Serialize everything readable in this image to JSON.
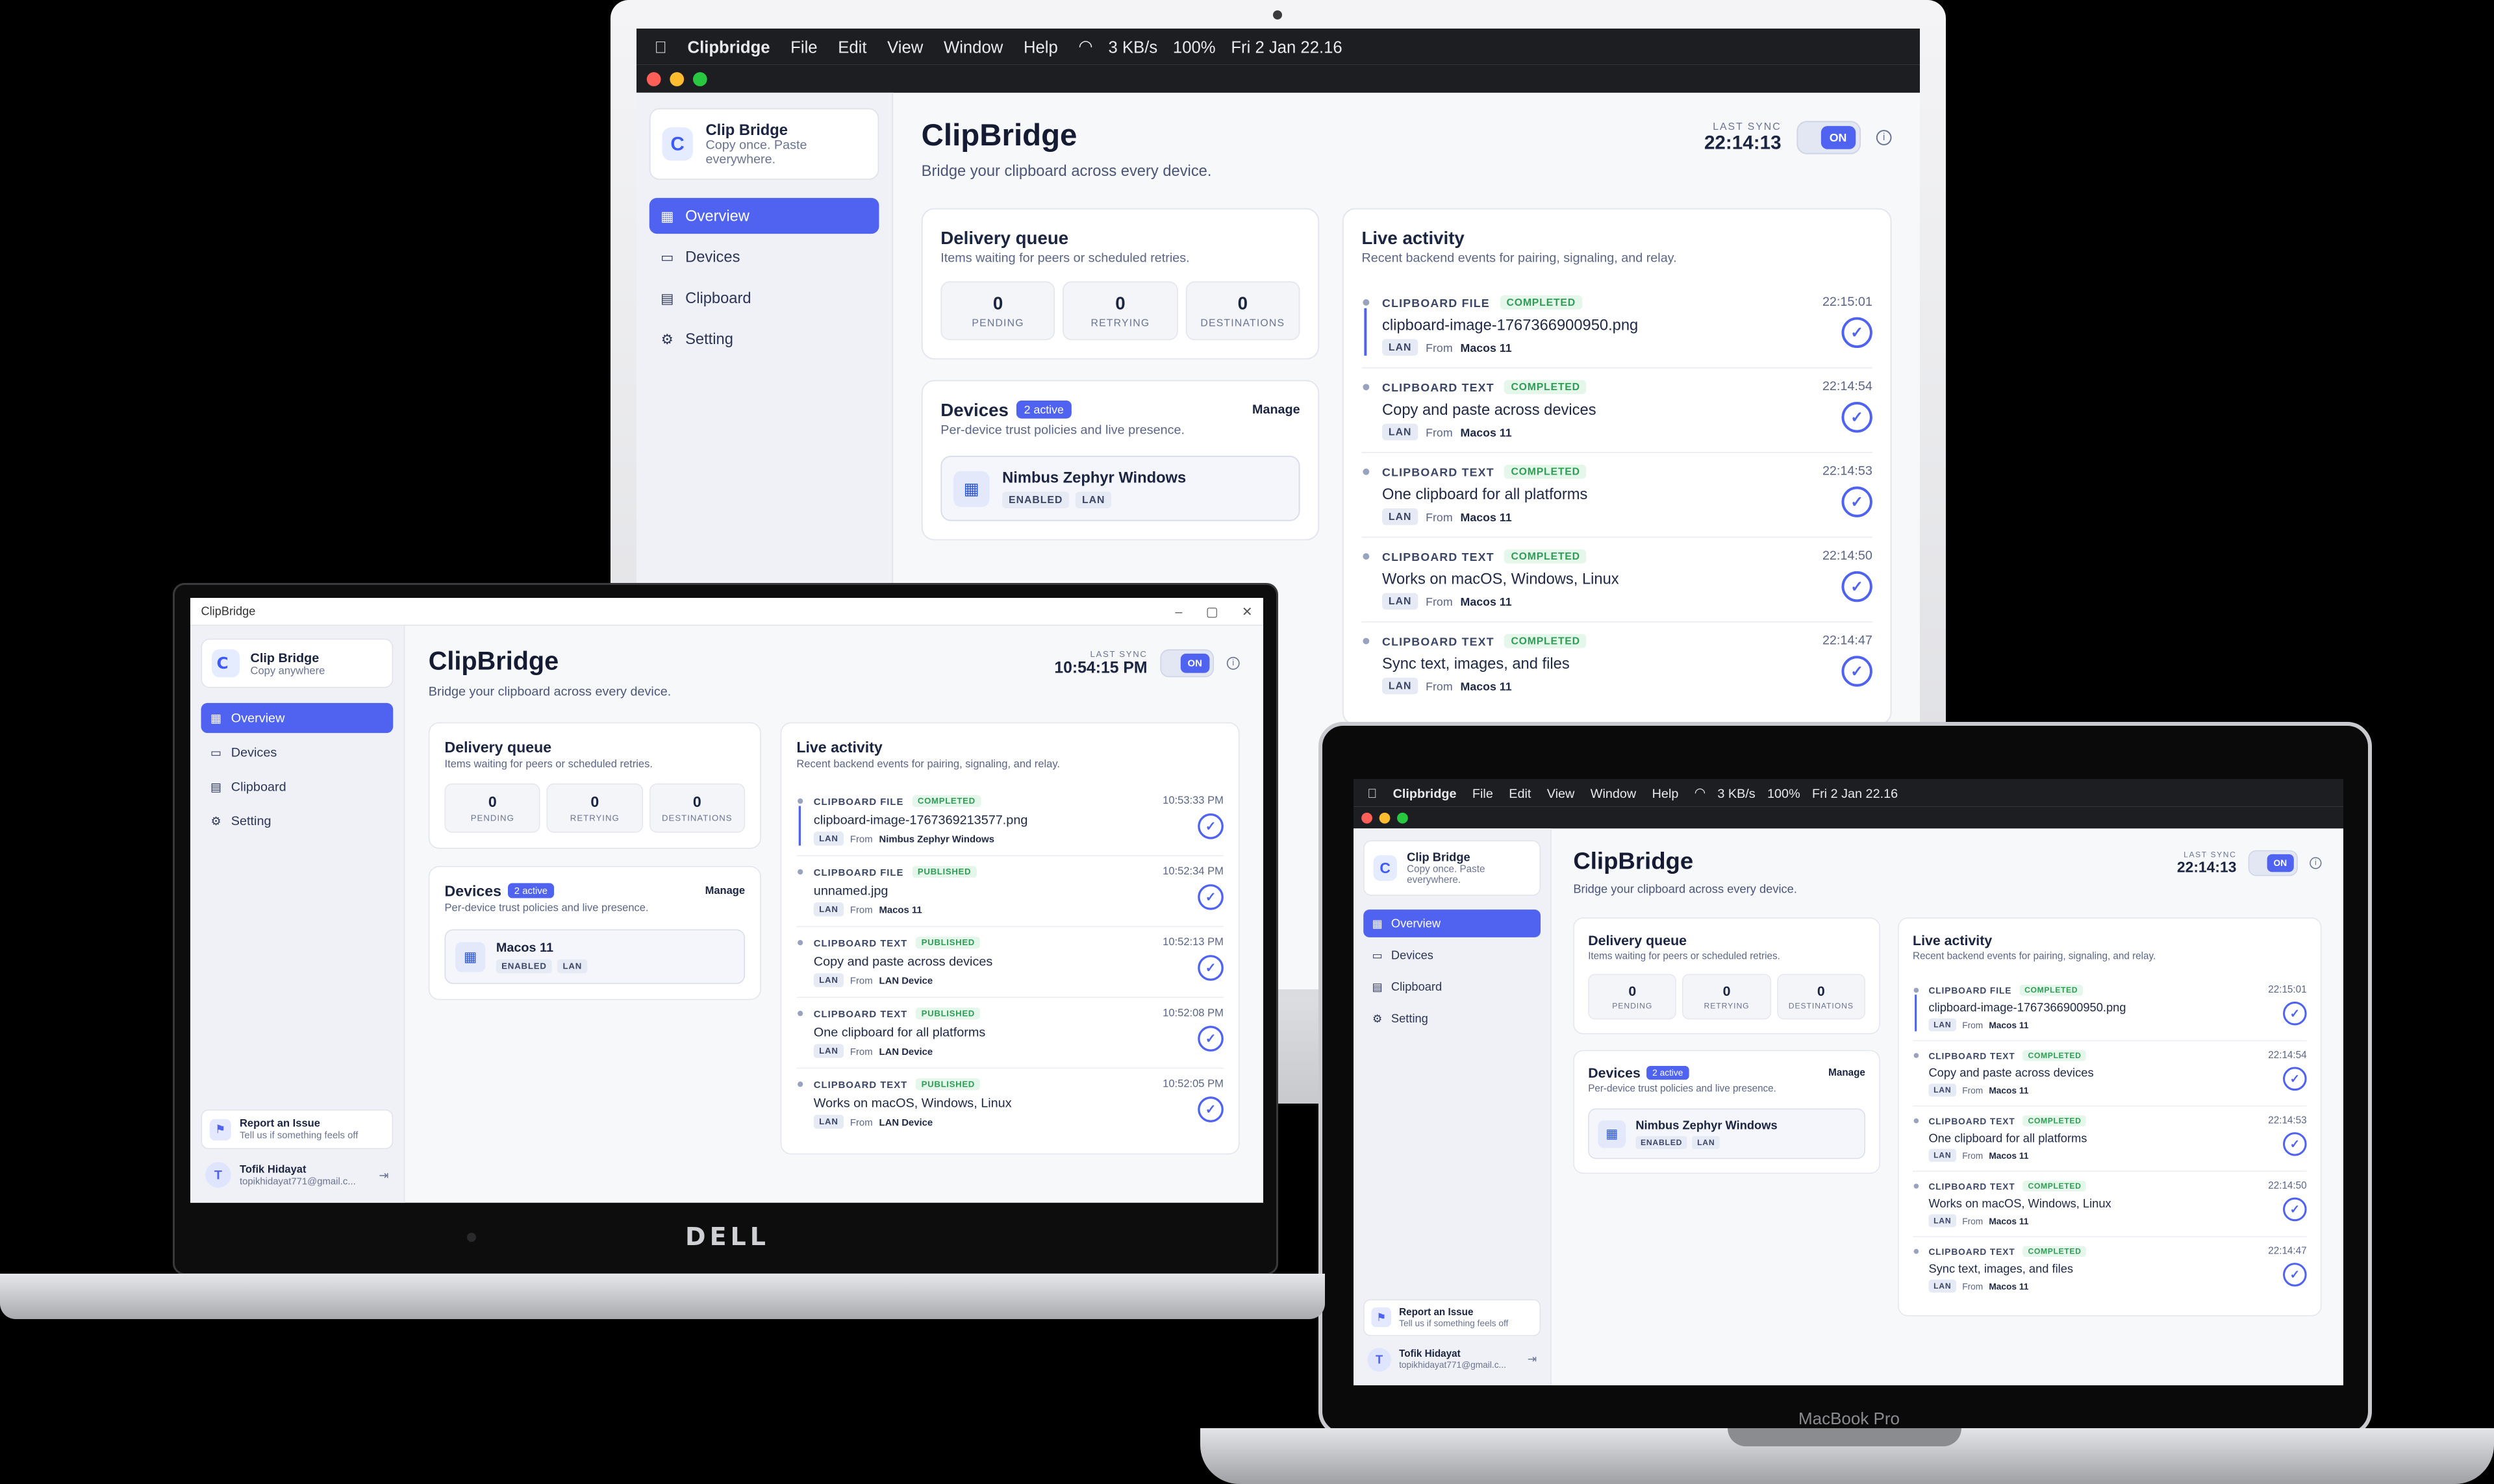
{
  "colors": {
    "accent": "#4f63f0",
    "success": "#2f9d55"
  },
  "hardware": {
    "dell_logo": "DELL",
    "macbook_label": "MacBook Pro"
  },
  "mac_menubar": {
    "apple": "",
    "app": "Clipbridge",
    "menus": [
      "File",
      "Edit",
      "View",
      "Window",
      "Help"
    ],
    "network": "3 KB/s",
    "battery": "100%",
    "datetime": "Fri 2 Jan  22.16"
  },
  "win_titlebar": {
    "title": "ClipBridge",
    "controls": [
      "–",
      "▢",
      "✕"
    ]
  },
  "mac_app": {
    "brand": {
      "name": "Clip Bridge",
      "tagline": "Copy once. Paste everywhere."
    },
    "nav": [
      {
        "label": "Overview",
        "icon": "grid-icon"
      },
      {
        "label": "Devices",
        "icon": "devices-icon"
      },
      {
        "label": "Clipboard",
        "icon": "clipboard-icon"
      },
      {
        "label": "Setting",
        "icon": "gear-icon"
      }
    ],
    "title": "ClipBridge",
    "subtitle": "Bridge your clipboard across every device.",
    "last_sync_label": "LAST SYNC",
    "last_sync_time": "22:14:13",
    "toggle": "ON",
    "queue": {
      "title": "Delivery queue",
      "subtitle": "Items waiting for peers or scheduled retries.",
      "stats": [
        {
          "value": "0",
          "label": "PENDING"
        },
        {
          "value": "0",
          "label": "RETRYING"
        },
        {
          "value": "0",
          "label": "DESTINATIONS"
        }
      ]
    },
    "devices": {
      "title": "Devices",
      "badge": "2 active",
      "manage": "Manage",
      "subtitle": "Per-device trust policies and live presence.",
      "device": {
        "name": "Nimbus Zephyr Windows",
        "tags": [
          "ENABLED",
          "LAN"
        ]
      }
    },
    "activity": {
      "title": "Live activity",
      "subtitle": "Recent backend events for pairing, signaling, and relay.",
      "items": [
        {
          "kind": "CLIPBOARD FILE",
          "status": "COMPLETED",
          "text": "clipboard-image-1767366900950.png",
          "net": "LAN",
          "from": "From",
          "source": "Macos 11",
          "time": "22:15:01"
        },
        {
          "kind": "CLIPBOARD TEXT",
          "status": "COMPLETED",
          "text": "Copy and paste across devices",
          "net": "LAN",
          "from": "From",
          "source": "Macos 11",
          "time": "22:14:54"
        },
        {
          "kind": "CLIPBOARD TEXT",
          "status": "COMPLETED",
          "text": "One clipboard for all platforms",
          "net": "LAN",
          "from": "From",
          "source": "Macos 11",
          "time": "22:14:53"
        },
        {
          "kind": "CLIPBOARD TEXT",
          "status": "COMPLETED",
          "text": "Works on macOS, Windows, Linux",
          "net": "LAN",
          "from": "From",
          "source": "Macos 11",
          "time": "22:14:50"
        },
        {
          "kind": "CLIPBOARD TEXT",
          "status": "COMPLETED",
          "text": "Sync text, images, and files",
          "net": "LAN",
          "from": "From",
          "source": "Macos 11",
          "time": "22:14:47"
        }
      ]
    },
    "report": {
      "title": "Report an Issue",
      "subtitle": "Tell us if something feels off"
    },
    "user": {
      "initial": "T",
      "name": "Tofik Hidayat",
      "email": "topikhidayat771@gmail.c..."
    }
  },
  "win_app": {
    "brand": {
      "name": "Clip Bridge",
      "tagline": "Copy anywhere"
    },
    "nav": [
      {
        "label": "Overview",
        "icon": "grid-icon"
      },
      {
        "label": "Devices",
        "icon": "devices-icon"
      },
      {
        "label": "Clipboard",
        "icon": "clipboard-icon"
      },
      {
        "label": "Setting",
        "icon": "gear-icon"
      }
    ],
    "title": "ClipBridge",
    "subtitle": "Bridge your clipboard across every device.",
    "last_sync_label": "LAST SYNC",
    "last_sync_time": "10:54:15 PM",
    "toggle": "ON",
    "queue": {
      "title": "Delivery queue",
      "subtitle": "Items waiting for peers or scheduled retries.",
      "stats": [
        {
          "value": "0",
          "label": "PENDING"
        },
        {
          "value": "0",
          "label": "RETRYING"
        },
        {
          "value": "0",
          "label": "DESTINATIONS"
        }
      ]
    },
    "devices": {
      "title": "Devices",
      "badge": "2 active",
      "manage": "Manage",
      "subtitle": "Per-device trust policies and live presence.",
      "device": {
        "name": "Macos 11",
        "tags": [
          "ENABLED",
          "LAN"
        ]
      }
    },
    "activity": {
      "title": "Live activity",
      "subtitle": "Recent backend events for pairing, signaling, and relay.",
      "items": [
        {
          "kind": "CLIPBOARD FILE",
          "status": "COMPLETED",
          "text": "clipboard-image-1767369213577.png",
          "net": "LAN",
          "from": "From",
          "source": "Nimbus Zephyr Windows",
          "time": "10:53:33 PM"
        },
        {
          "kind": "CLIPBOARD FILE",
          "status": "PUBLISHED",
          "text": "unnamed.jpg",
          "net": "LAN",
          "from": "From",
          "source": "Macos 11",
          "time": "10:52:34 PM"
        },
        {
          "kind": "CLIPBOARD TEXT",
          "status": "PUBLISHED",
          "text": "Copy and paste across devices",
          "net": "LAN",
          "from": "From",
          "source": "LAN Device",
          "time": "10:52:13 PM"
        },
        {
          "kind": "CLIPBOARD TEXT",
          "status": "PUBLISHED",
          "text": "One clipboard for all platforms",
          "net": "LAN",
          "from": "From",
          "source": "LAN Device",
          "time": "10:52:08 PM"
        },
        {
          "kind": "CLIPBOARD TEXT",
          "status": "PUBLISHED",
          "text": "Works on macOS, Windows, Linux",
          "net": "LAN",
          "from": "From",
          "source": "LAN Device",
          "time": "10:52:05 PM"
        }
      ]
    },
    "report": {
      "title": "Report an Issue",
      "subtitle": "Tell us if something feels off"
    },
    "user": {
      "initial": "T",
      "name": "Tofik Hidayat",
      "email": "topikhidayat771@gmail.c..."
    }
  }
}
